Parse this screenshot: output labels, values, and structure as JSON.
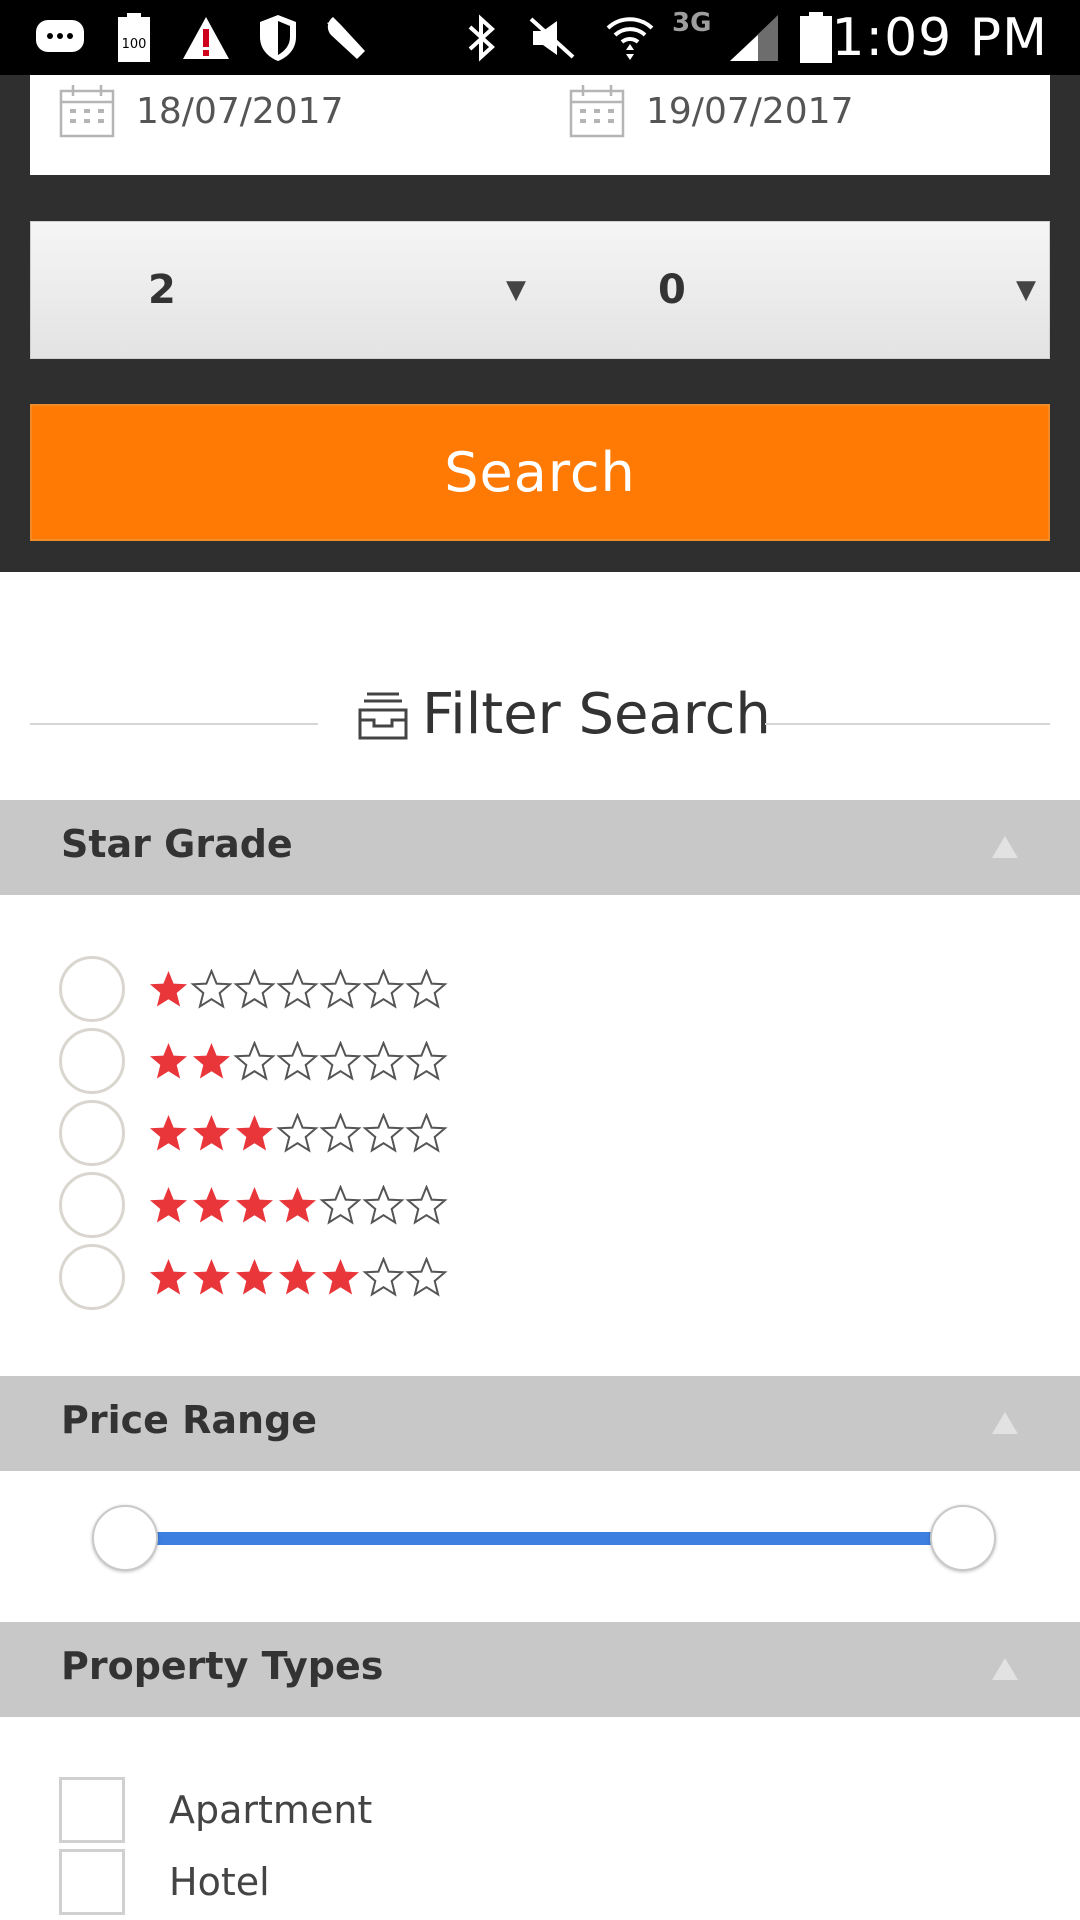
{
  "status_bar": {
    "time": "1:09 PM",
    "network": "3G",
    "battery_level_text": "100",
    "icons": [
      "messenger-icon",
      "battery-100-icon",
      "warning-icon",
      "shield-icon",
      "wrench-icon",
      "bluetooth-icon",
      "mute-icon",
      "wifi-icon",
      "signal-icon",
      "battery-icon"
    ]
  },
  "search_panel": {
    "check_in": "18/07/2017",
    "check_out": "19/07/2017",
    "adults": "2",
    "children": "0",
    "dropdown_arrow": "▼",
    "search_label": "Search",
    "accent_color": "#ff7a05"
  },
  "filter": {
    "title": "Filter Search",
    "sections": {
      "star_grade": {
        "label": "Star Grade",
        "options": [
          {
            "filled": 1,
            "total": 7
          },
          {
            "filled": 2,
            "total": 7
          },
          {
            "filled": 3,
            "total": 7
          },
          {
            "filled": 4,
            "total": 7
          },
          {
            "filled": 5,
            "total": 7
          }
        ],
        "filled_color": "#e8363b"
      },
      "price_range": {
        "label": "Price Range",
        "min_fraction": 0.0,
        "max_fraction": 1.0,
        "track_color": "#3d7fe0"
      },
      "property_types": {
        "label": "Property Types",
        "options": [
          "Apartment",
          "Hotel"
        ]
      }
    }
  }
}
